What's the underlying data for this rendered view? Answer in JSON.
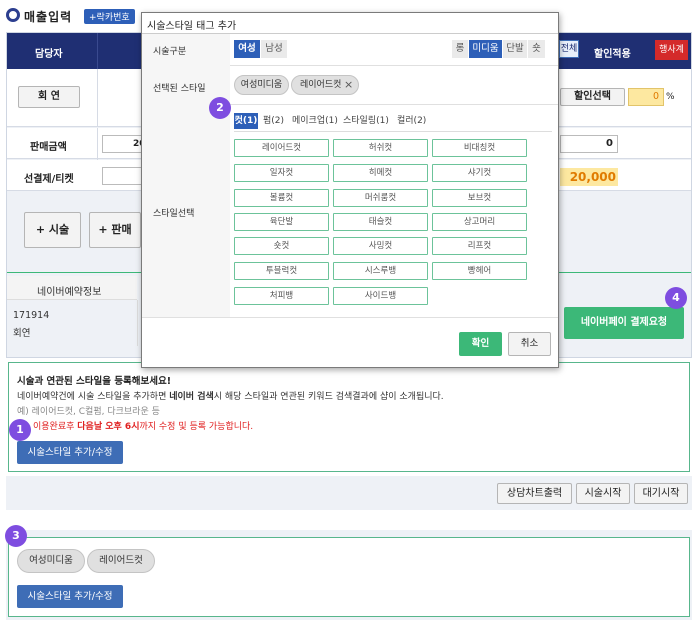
{
  "page": {
    "title": "매출입력",
    "lacquer_button": "+락카번호",
    "header_columns": [
      "담당자",
      "할인적용"
    ],
    "header_tags": {
      "full": "전체",
      "event": "행사계"
    },
    "row1": {
      "button": "회 연",
      "discount_select": "할인선택",
      "discount_value": "0",
      "discount_unit": "%"
    },
    "row2": {
      "label": "판매금액",
      "value_left": "20",
      "value_right": "0"
    },
    "row3": {
      "label": "선결제/티켓",
      "value_right": "20,000"
    },
    "buttons": {
      "add_treatment": "+ 시술",
      "add_sale": "+ 판매"
    },
    "naver": {
      "header": "네이버예약정보",
      "reservation_id": "171914",
      "customer": "회연",
      "pay_button": "네이버페이 결제요청"
    },
    "guide": {
      "heading": "시술과 연관된 스타일을 등록해보세요!",
      "line1_pre": "네이버예약건에 시술 스타일을 추가하면 ",
      "line1_bold": "네이버 검색",
      "line1_post": "시 해당 스타일과 연관된 키워드 검색결과에 샵이 소개됩니다.",
      "line2": "예) 레이어드컷, C컬펌, 다크브라운 등",
      "warning_pre": "이용완료후 ",
      "warning_bold": "다음날 오후 6시",
      "warning_post": "까지 수정 및 등록 가능합니다.",
      "button": "시술스타일 추가/수정"
    },
    "bottom_buttons": [
      "상담차트출력",
      "시술시작",
      "대기시작"
    ],
    "selected_box": {
      "tags": [
        "여성미디움",
        "레이어드컷"
      ],
      "button": "시술스타일 추가/수정"
    },
    "markers": [
      "1",
      "2",
      "3",
      "4"
    ]
  },
  "modal": {
    "title": "시술스타일 태그 추가",
    "category_label": "시술구분",
    "gender": [
      "여성",
      "남성"
    ],
    "gender_active": "여성",
    "length": [
      "롱",
      "미디움",
      "단발",
      "숏"
    ],
    "length_active": "미디움",
    "selected_label": "선택된 스타일",
    "selected_tags": [
      "여성미디움",
      "레이어드컷"
    ],
    "style_label": "스타일선택",
    "tabs": [
      "컷(1)",
      "펌(2)",
      "메이크업(1)",
      "스타일링(1)",
      "컬러(2)"
    ],
    "tab_active": "컷(1)",
    "styles": [
      "레이어드컷",
      "허쉬컷",
      "비대칭컷",
      "일자컷",
      "히메컷",
      "샤기컷",
      "볼륨컷",
      "머쉬룸컷",
      "보브컷",
      "육단발",
      "태슬컷",
      "상고머리",
      "숏컷",
      "사밍컷",
      "리프컷",
      "투블럭컷",
      "시스루뱅",
      "빵헤어",
      "처피뱅",
      "사이드뱅"
    ],
    "confirm": "확인",
    "cancel": "취소"
  },
  "colors": {
    "navy": "#1f2f73",
    "blue_button": "#3e6db6",
    "green": "#3cb878",
    "purple_marker": "#7e4de0",
    "red_text": "#e02020",
    "orange_field": "#fde8a0"
  }
}
